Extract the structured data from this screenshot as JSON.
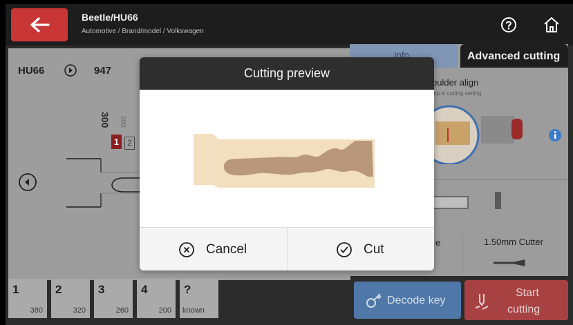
{
  "header": {
    "title": "Beetle/HU66",
    "breadcrumb": "Automotive / Brand/model / Volkswagen"
  },
  "key_panel": {
    "key_code": "HU66",
    "key_number": "947",
    "depth_label": "300",
    "depth_label_2": "000",
    "cut_badge_1": "1",
    "cut_badge_2": "2"
  },
  "cut_positions": [
    {
      "index": "1",
      "value": "380"
    },
    {
      "index": "2",
      "value": "320"
    },
    {
      "index": "3",
      "value": "260"
    },
    {
      "index": "4",
      "value": "200"
    },
    {
      "index": "?",
      "value": "known"
    }
  ],
  "right_panel": {
    "tab_info": "Info",
    "tab_advanced": "Advanced cutting",
    "shoulder_title": "oulder align",
    "shoulder_sub": "mp in cutting setting",
    "partial_label": "e",
    "cutter_label": "1.50mm Cutter",
    "decode_button": "Decode key",
    "start_button_line1": "Start",
    "start_button_line2": "cutting"
  },
  "modal": {
    "title": "Cutting preview",
    "cancel_label": "Cancel",
    "cut_label": "Cut"
  },
  "colors": {
    "back_button": "#c83636",
    "key_blank": "#f2dfbf",
    "key_cut": "#b9977b",
    "start_button": "#a84242",
    "decode_button": "#4f78a8"
  }
}
